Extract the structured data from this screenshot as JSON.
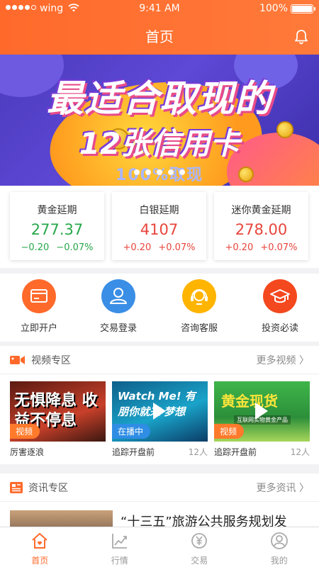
{
  "status": {
    "carrier": "wing",
    "time": "9:41 AM",
    "battery": "100%"
  },
  "header": {
    "title": "首页"
  },
  "banner": {
    "line1": "最适合取现的",
    "line2": "12张信用卡",
    "line3": "100%取现",
    "slides": 5
  },
  "quotes": [
    {
      "name": "黄金延期",
      "price": "277.37",
      "change": "−0.20",
      "pct": "−0.07%",
      "color": "green"
    },
    {
      "name": "白银延期",
      "price": "4107",
      "change": "+0.20",
      "pct": "+0.07%",
      "color": "red"
    },
    {
      "name": "迷你黄金延期",
      "price": "278.00",
      "change": "+0.20",
      "pct": "+0.07%",
      "color": "red"
    }
  ],
  "quick": [
    "立即开户",
    "交易登录",
    "咨询客服",
    "投资必读"
  ],
  "video": {
    "title": "视频专区",
    "more": "更多视频 〉",
    "items": [
      {
        "tag": "视频",
        "caption": "厉害逐浪",
        "count": "",
        "thumb_text": "无惧降息 收益不停息"
      },
      {
        "tag": "在播中",
        "caption": "追踪开盘前",
        "count": "12人",
        "thumb_text": "Watch Me! 有朋你就来 梦想"
      },
      {
        "tag": "视频",
        "caption": "追踪开盘前",
        "count": "12人",
        "thumb_text": "黄金现货",
        "thumb_sub": "互联网实物黄金产品"
      }
    ]
  },
  "news": {
    "title": "资讯专区",
    "more": "更多资讯 〉",
    "headline": "“十三五”旅游公共服务规划发"
  },
  "tabs": [
    "首页",
    "行情",
    "交易",
    "我的"
  ],
  "colors": {
    "accent": "#ff6a2b",
    "up": "#e8453c",
    "down": "#27a84a"
  }
}
